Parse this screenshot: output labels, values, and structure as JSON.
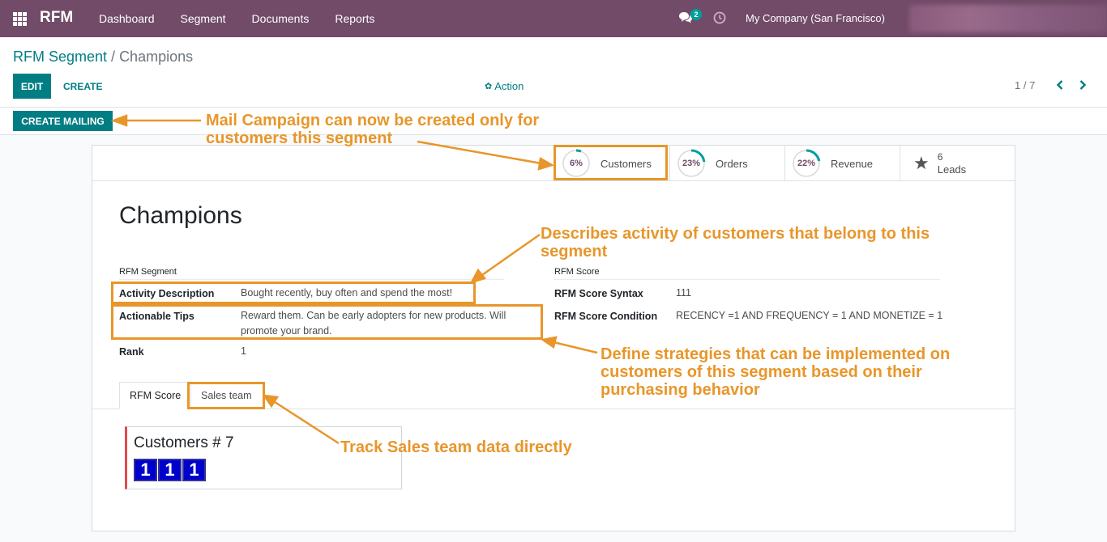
{
  "navbar": {
    "brand": "RFM",
    "menu": [
      "Dashboard",
      "Segment",
      "Documents",
      "Reports"
    ],
    "chat_badge": "2",
    "company": "My Company (San Francisco)"
  },
  "breadcrumb": {
    "parent": "RFM Segment",
    "separator": " / ",
    "current": "Champions"
  },
  "toolbar": {
    "edit_label": "EDIT",
    "create_label": "CREATE",
    "action_label": "Action",
    "pager": "1 / 7"
  },
  "statusbar": {
    "create_mailing_label": "CREATE MAILING"
  },
  "stat_buttons": {
    "customers": {
      "percent": "6%",
      "fraction": 0.06,
      "label": "Customers"
    },
    "orders": {
      "percent": "23%",
      "fraction": 0.23,
      "label": "Orders"
    },
    "revenue": {
      "percent": "22%",
      "fraction": 0.22,
      "label": "Revenue"
    },
    "leads": {
      "count": "6",
      "label": "Leads"
    }
  },
  "record": {
    "title": "Champions",
    "left_group": {
      "title": "RFM Segment",
      "fields": [
        {
          "label": "Activity Description",
          "value": "Bought recently, buy often and spend the most!"
        },
        {
          "label": "Actionable Tips",
          "value": "Reward them. Can be early adopters for new products. Will promote your brand."
        },
        {
          "label": "Rank",
          "value": "1"
        }
      ]
    },
    "right_group": {
      "title": "RFM Score",
      "fields": [
        {
          "label": "RFM Score Syntax",
          "value": "111"
        },
        {
          "label": "RFM Score Condition",
          "value": "RECENCY =1 AND FREQUENCY = 1 AND MONETIZE = 1"
        }
      ]
    }
  },
  "tabs": [
    {
      "label": "RFM Score",
      "active": true
    },
    {
      "label": "Sales team",
      "active": false
    }
  ],
  "kanban_card": {
    "title": "Customers # 7",
    "scores": [
      "1",
      "1",
      "1"
    ]
  },
  "annotations": {
    "mailing": "Mail Campaign can now be created only for customers this segment",
    "activity": "Describes activity of customers that belong to this segment",
    "tips": "Define strategies that can be implemented on customers of this segment based on their purchasing behavior",
    "sales_team": "Track Sales team data directly"
  },
  "colors": {
    "navbar": "#714b67",
    "primary": "#017e84",
    "annotation": "#e8962a",
    "score_box": "#0000cc"
  },
  "icons": {
    "apps": "apps-grid-icon",
    "chat": "chat-icon",
    "clock": "clock-icon",
    "action": "gear-icon",
    "pager_prev": "chevron-left-icon",
    "pager_next": "chevron-right-icon",
    "leads": "star-icon"
  }
}
